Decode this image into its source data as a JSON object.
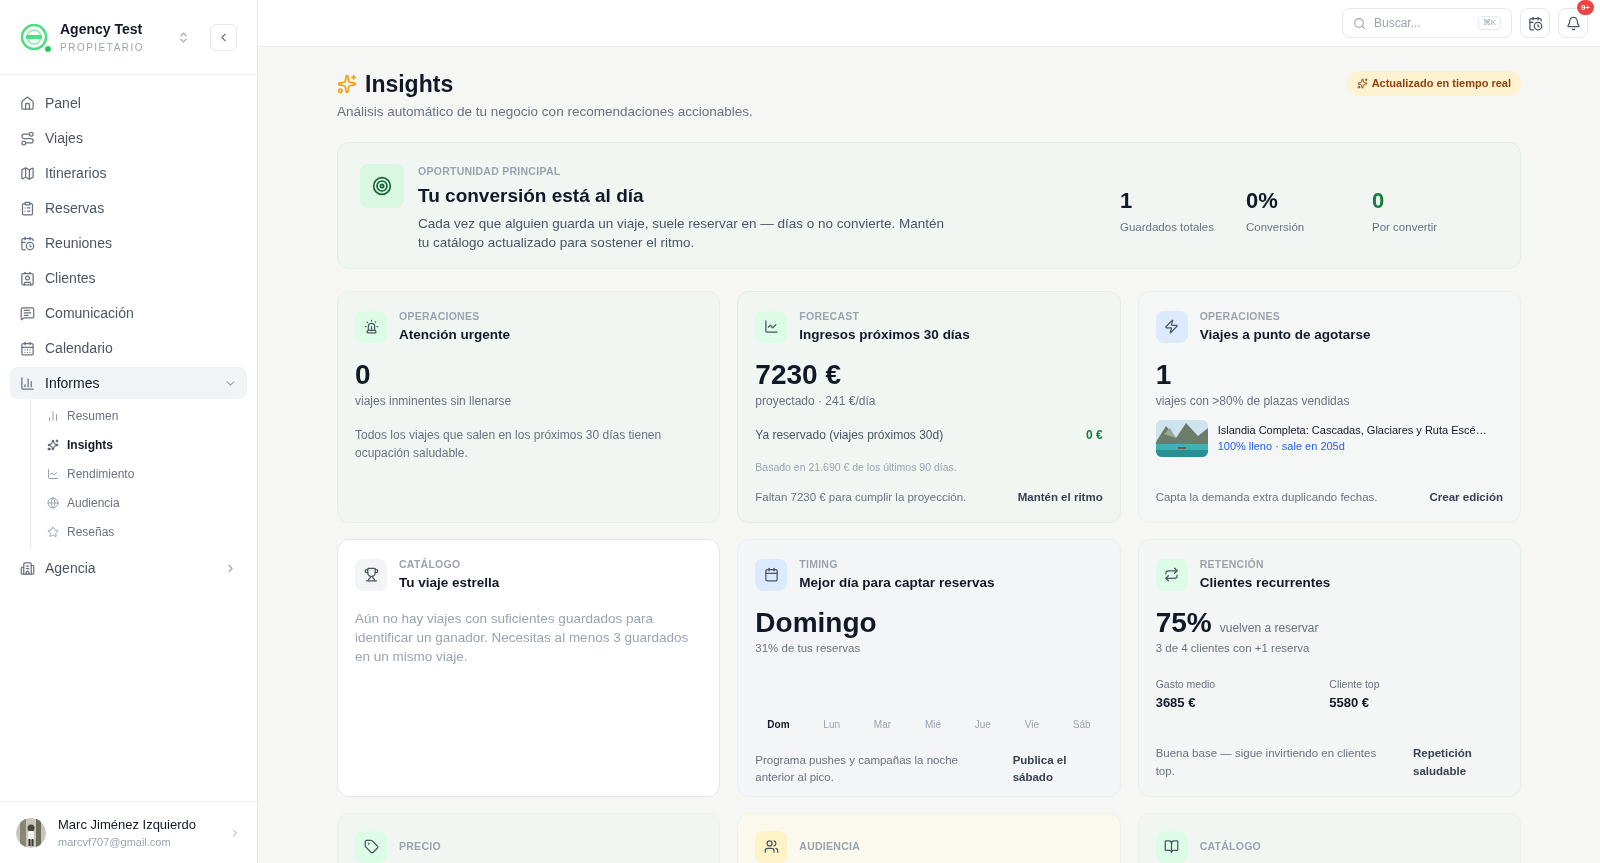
{
  "sidebar": {
    "workspace": {
      "name": "Agency Test",
      "role": "PROPIETARIO",
      "online": true
    },
    "nav": [
      {
        "label": "Panel",
        "selected": false
      },
      {
        "label": "Viajes",
        "selected": false
      },
      {
        "label": "Itinerarios",
        "selected": false
      },
      {
        "label": "Reservas",
        "selected": false
      },
      {
        "label": "Reuniones",
        "selected": false
      },
      {
        "label": "Clientes",
        "selected": false
      },
      {
        "label": "Comunicación",
        "selected": false
      },
      {
        "label": "Calendario",
        "selected": false
      },
      {
        "label": "Informes",
        "selected": false,
        "expanded": true,
        "children": [
          {
            "label": "Resumen",
            "selected": false
          },
          {
            "label": "Insights",
            "selected": true
          },
          {
            "label": "Rendimiento",
            "selected": false
          },
          {
            "label": "Audiencia",
            "selected": false
          },
          {
            "label": "Reseñas",
            "selected": false
          }
        ]
      },
      {
        "label": "Agencia",
        "selected": false,
        "expanded": false
      }
    ],
    "user": {
      "name": "Marc Jiménez Izquierdo",
      "email": "marcvf707@gmail.com"
    }
  },
  "topbar": {
    "search": {
      "placeholder": "Buscar...",
      "shortcut": "⌘K"
    },
    "notifications": "9+"
  },
  "header": {
    "title": "Insights",
    "subtitle": "Análisis automático de tu negocio con recomendaciones accionables.",
    "badge": "Actualizado en tiempo real"
  },
  "highlight": {
    "eyebrow": "OPORTUNIDAD PRINCIPAL",
    "title": "Tu conversión está al día",
    "text": "Cada vez que alguien guarda un viaje, suele reservar en — días o no convierte. Mantén tu catálogo actualizado para sostener el ritmo.",
    "stats": [
      {
        "value": "1",
        "label": "Guardados totales",
        "accent": false
      },
      {
        "value": "0%",
        "label": "Conversión",
        "accent": false
      },
      {
        "value": "0",
        "label": "Por convertir",
        "accent": true
      }
    ]
  },
  "cards": [
    {
      "kind": "metric",
      "color": "#dcfce7",
      "eyebrow": "OPERACIONES",
      "title": "Atención urgente",
      "value": "0",
      "caption": "viajes inminentes sin llenarse",
      "note": "Todos los viajes que salen en los próximos 30 días tienen ocupación saludable."
    },
    {
      "kind": "forecast",
      "color": "#dcfce7",
      "eyebrow": "FORECAST",
      "title": "Ingresos próximos 30 días",
      "value": "7230 €",
      "caption": "proyectado · 241 €/día",
      "row_label": "Ya reservado (viajes próximos 30d)",
      "row_value": "0 €",
      "basis": "Basado en 21.690 € de los últimos 90 días.",
      "footer": "Faltan 7230 € para cumplir la proyección.",
      "action": "Mantén el ritmo"
    },
    {
      "kind": "trips",
      "color": "#dbeafe",
      "eyebrow": "OPERACIONES",
      "title": "Viajes a punto de agotarse",
      "value": "1",
      "caption": "viajes con >80% de plazas vendidas",
      "trip": {
        "kind": "picture",
        "name": "Islandia Completa: Cascadas, Glaciares y Ruta Escé…",
        "meta": "100% lleno · sale en 205d"
      },
      "footer": "Capta la demanda extra duplicando fechas.",
      "action": "Crear edición"
    },
    {
      "kind": "empty",
      "color": "#f3f4f6",
      "eyebrow": "CATÁLOGO",
      "title": "Tu viaje estrella",
      "note": "Aún no hay viajes con suficientes guardados para identificar un ganador. Necesitas al menos 3 guardados en un mismo viaje."
    },
    {
      "kind": "timing",
      "color": "#dbeafe",
      "eyebrow": "TIMING",
      "title": "Mejor día para captar reservas",
      "value": "Domingo",
      "caption": "31% de tus reservas",
      "days": [
        {
          "label": "Dom",
          "selected": true
        },
        {
          "label": "Lun",
          "selected": false
        },
        {
          "label": "Mar",
          "selected": false
        },
        {
          "label": "Mié",
          "selected": false
        },
        {
          "label": "Jue",
          "selected": false
        },
        {
          "label": "Vie",
          "selected": false
        },
        {
          "label": "Sáb",
          "selected": false
        }
      ],
      "footer": "Programa pushes y campañas la noche anterior al pico.",
      "action": "Publica el sábado"
    },
    {
      "kind": "retention",
      "color": "#dcfce7",
      "eyebrow": "RETENCIÓN",
      "title": "Clientes recurrentes",
      "value": "75%",
      "value_suffix": "vuelven a reservar",
      "caption": "3 de 4 clientes con +1 reserva",
      "figures": [
        {
          "label": "Gasto medio",
          "value": "3685 €"
        },
        {
          "label": "Cliente top",
          "value": "5580 €"
        }
      ],
      "footer": "Buena base — sigue invirtiendo en clientes top.",
      "action": "Repetición saludable"
    },
    {
      "kind": "teaser",
      "color": "#dcfce7",
      "eyebrow": "PRECIO"
    },
    {
      "kind": "teaser",
      "color": "#fef3c7",
      "eyebrow": "AUDIENCIA"
    },
    {
      "kind": "teaser",
      "color": "#dcfce7",
      "eyebrow": "CATÁLOGO"
    }
  ]
}
